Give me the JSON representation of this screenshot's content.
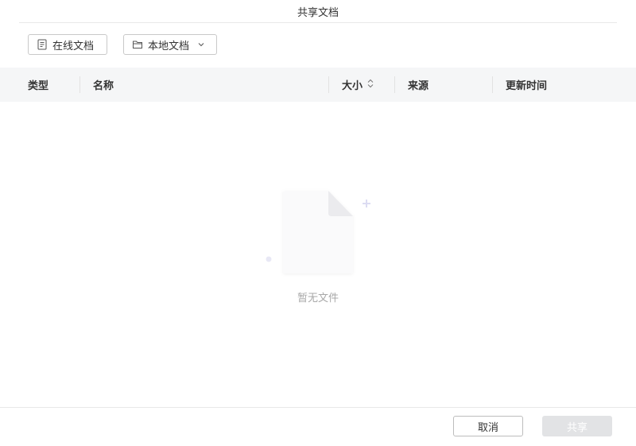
{
  "dialog": {
    "title": "共享文档"
  },
  "toolbar": {
    "online_docs_label": "在线文档",
    "local_docs_label": "本地文档"
  },
  "table": {
    "columns": [
      "类型",
      "名称",
      "大小",
      "来源",
      "更新时间"
    ],
    "rows": []
  },
  "empty_state": {
    "text": "暂无文件"
  },
  "footer": {
    "cancel_label": "取消",
    "share_label": "共享"
  },
  "icons": {
    "online_docs": "document-icon",
    "local_docs": "folder-icon",
    "dropdown": "chevron-down-icon",
    "sort": "sort-icon",
    "empty": "empty-file-icon"
  },
  "colors": {
    "header_bg": "#f5f6f7",
    "disabled_button_bg": "#e2e3e5",
    "empty_text": "#a8a8a8"
  }
}
